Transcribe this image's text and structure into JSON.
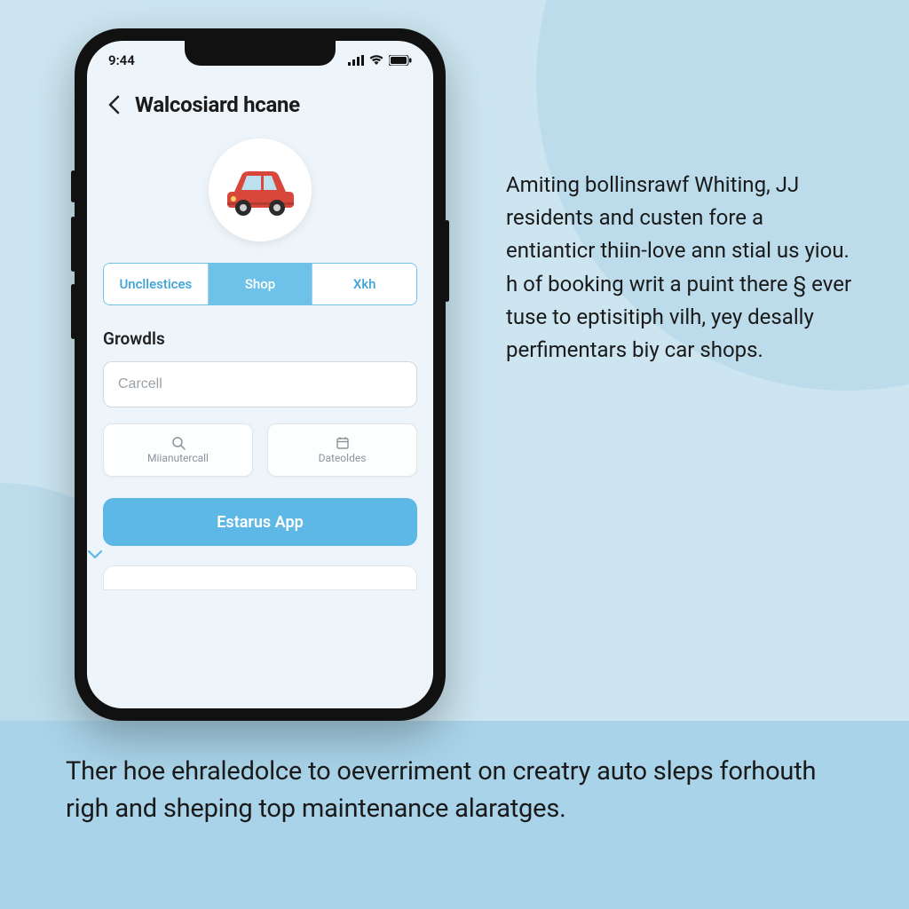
{
  "status_bar": {
    "time": "9:44"
  },
  "header": {
    "title": "Walcosiard hcane"
  },
  "tabs": [
    {
      "label": "Uncllestices",
      "active": false
    },
    {
      "label": "Shop",
      "active": true
    },
    {
      "label": "Xkh",
      "active": false
    }
  ],
  "section": {
    "title": "Growdls",
    "input_placeholder": "Carcell"
  },
  "pills": [
    {
      "label": "Miianutercall",
      "icon": "search-icon"
    },
    {
      "label": "Dateoldes",
      "icon": "calendar-icon"
    }
  ],
  "primary_button": {
    "label": "Estarus App"
  },
  "side_paragraph": "Amiting bollinsrawf Whiting, JJ residents and custen fore a entianticr thiin-love ann stial us yiou. h of booking writ a puint there § ever tuse to eptisitiph vilh, yey desally perfimentars biy car shops.",
  "bottom_paragraph": "Ther hoe ehraledolce to oeverriment on creatry auto sleps forhouth righ and sheping top maintenance alaratges.",
  "colors": {
    "accent": "#5db8e6",
    "tab_accent": "#6ec1e8",
    "bg": "#cce5f0"
  }
}
